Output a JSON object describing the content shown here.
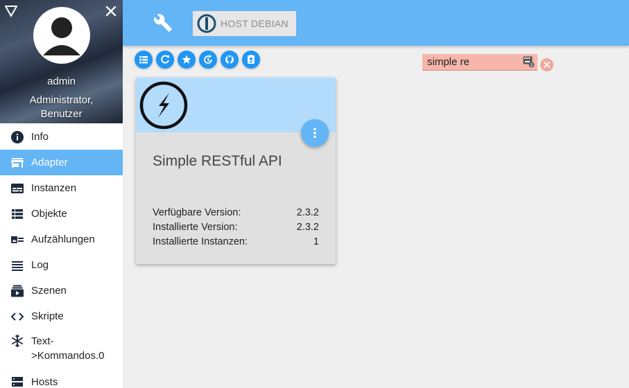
{
  "profile": {
    "username": "admin",
    "roles_line1": "Administrator,",
    "roles_line2": "Benutzer"
  },
  "nav": [
    {
      "label": "Info",
      "icon": "info-icon"
    },
    {
      "label": "Adapter",
      "icon": "store-icon",
      "active": true
    },
    {
      "label": "Instanzen",
      "icon": "instances-icon"
    },
    {
      "label": "Objekte",
      "icon": "list-icon"
    },
    {
      "label": "Aufzählungen",
      "icon": "enum-icon"
    },
    {
      "label": "Log",
      "icon": "log-icon"
    },
    {
      "label": "Szenen",
      "icon": "scenes-icon"
    },
    {
      "label": "Skripte",
      "icon": "code-icon"
    },
    {
      "label": "Text-\n>Kommandos.0",
      "icon": "snowflake-icon"
    },
    {
      "label": "Hosts",
      "icon": "hosts-icon"
    }
  ],
  "topbar": {
    "host_label": "HOST DEBIAN",
    "accent": "#64b5f6"
  },
  "toolbar": {
    "buttons": [
      "list-view-icon",
      "refresh-icon",
      "star-icon",
      "update-icon",
      "github-icon",
      "contact-icon"
    ]
  },
  "search": {
    "value": "simple re"
  },
  "card": {
    "title": "Simple RESTful API",
    "rows": [
      {
        "label": "Verfügbare Version:",
        "value": "2.3.2"
      },
      {
        "label": "Installierte Version:",
        "value": "2.3.2"
      },
      {
        "label": "Installierte Instanzen:",
        "value": "1"
      }
    ]
  }
}
